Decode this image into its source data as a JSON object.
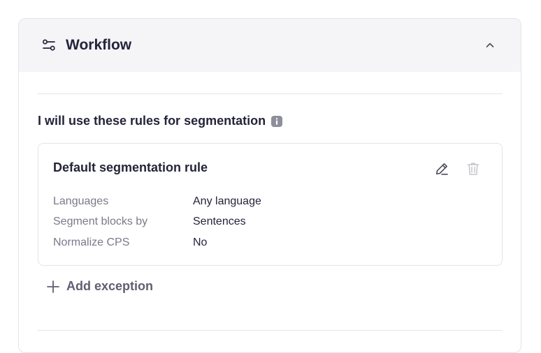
{
  "panel": {
    "title": "Workflow",
    "icon": "sliders-icon",
    "collapse_icon": "chevron-up-icon"
  },
  "section": {
    "heading": "I will use these rules for segmentation",
    "info_icon": "info-icon"
  },
  "rule": {
    "title": "Default segmentation rule",
    "rows": [
      {
        "label": "Languages",
        "value": "Any language"
      },
      {
        "label": "Segment blocks by",
        "value": "Sentences"
      },
      {
        "label": "Normalize CPS",
        "value": "No"
      }
    ],
    "edit_icon": "pencil-icon",
    "delete_icon": "trash-icon",
    "delete_disabled": true
  },
  "add_exception": {
    "label": "Add exception",
    "icon": "plus-icon"
  },
  "colors": {
    "text": "#24243a",
    "muted": "#7a7a8a",
    "header_bg": "#f5f5f8",
    "border": "#e4e4ea"
  }
}
